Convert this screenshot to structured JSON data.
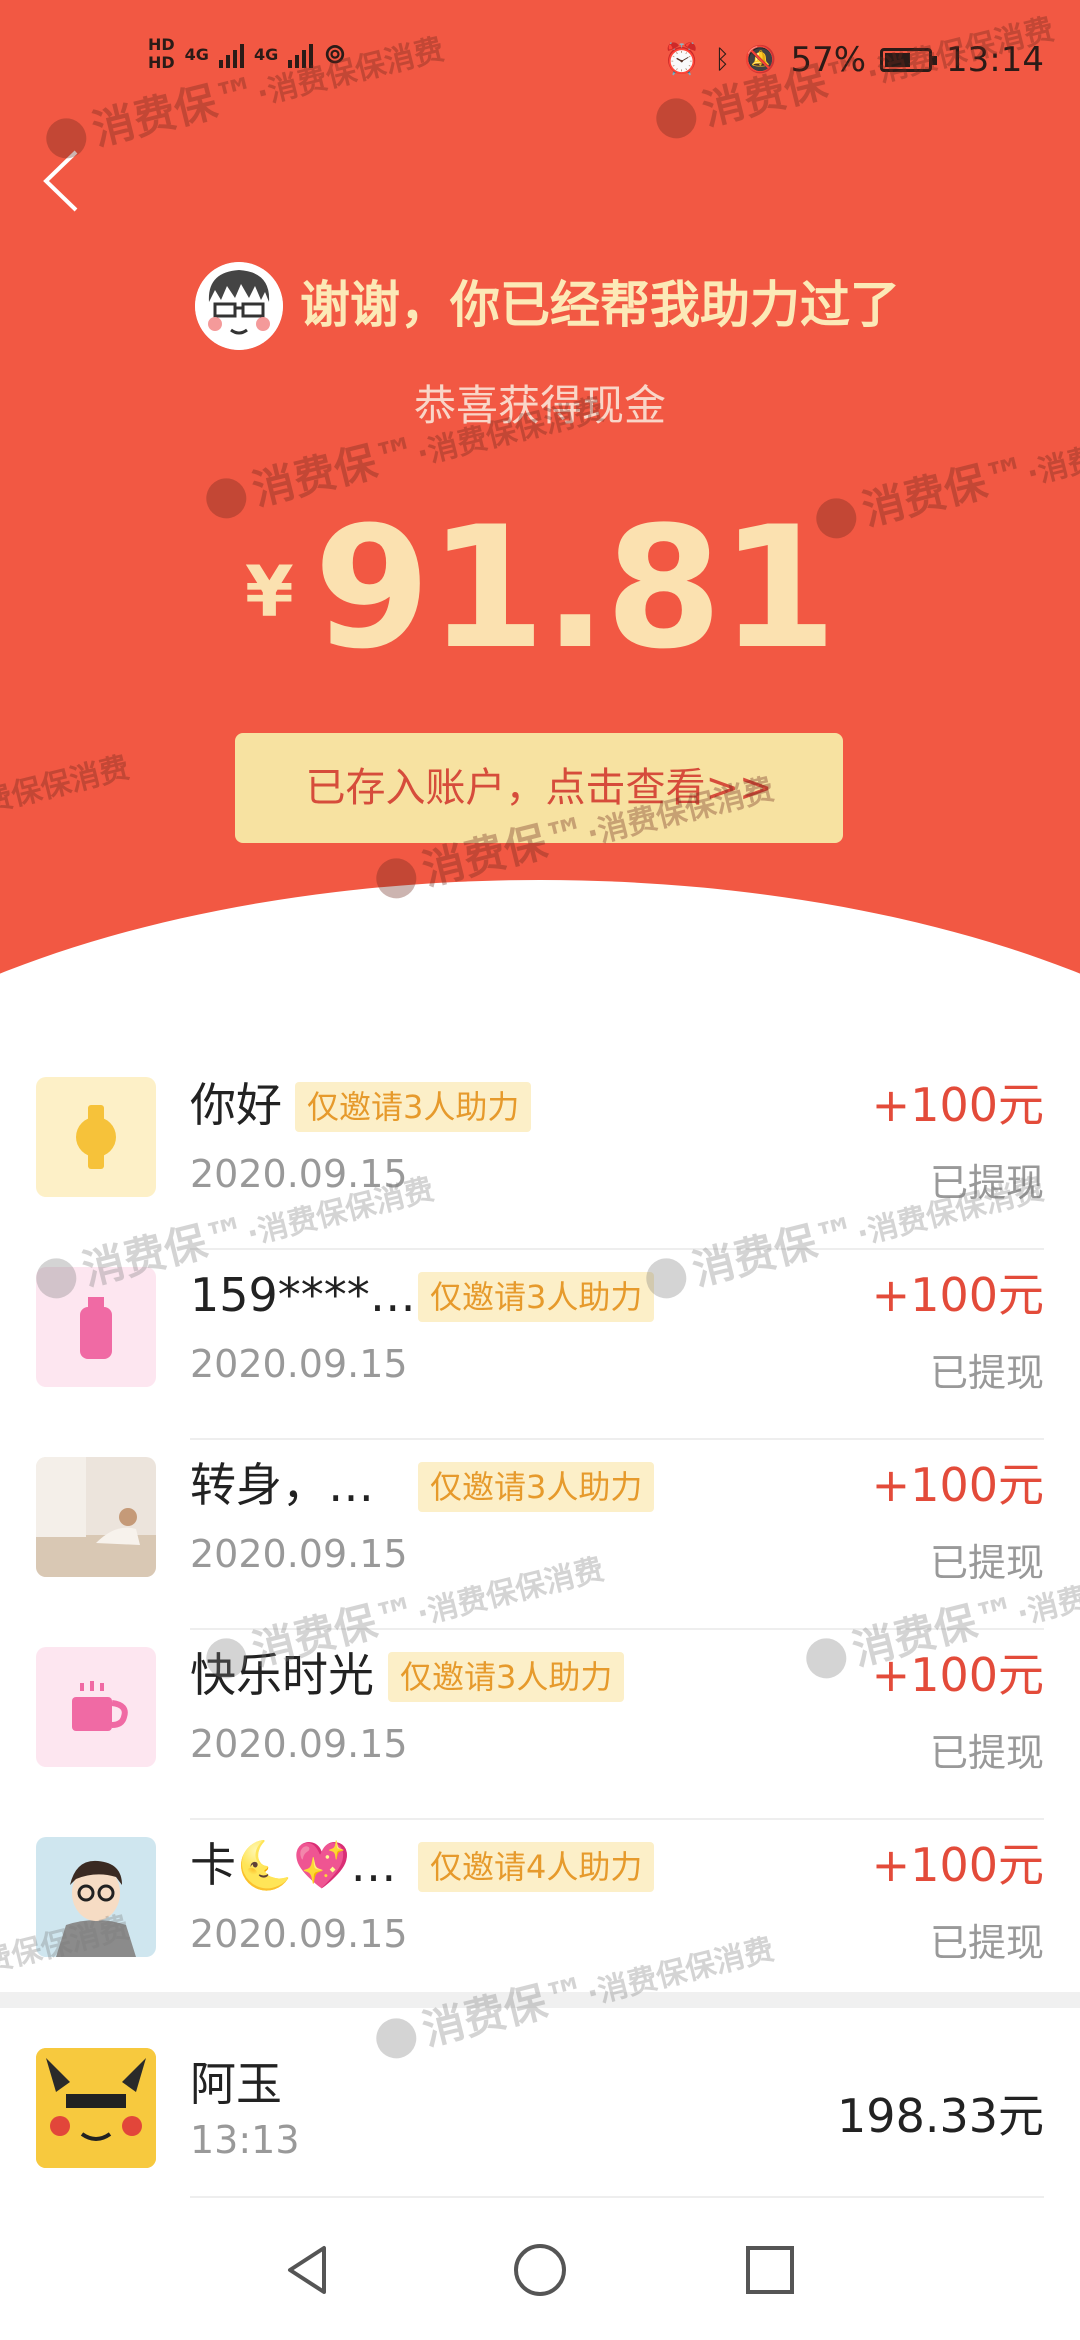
{
  "status_bar": {
    "hd_top": "HD",
    "hd_bottom": "HD",
    "net1": "4G",
    "net2": "4G",
    "battery_percent": "57%",
    "time": "13:14",
    "battery_level": 0.57
  },
  "header": {
    "thanks_text": "谢谢，你已经帮我助力过了",
    "congrats_text": "恭喜获得现金",
    "currency_symbol": "¥",
    "amount": "91.81",
    "deposit_button": "已存入账户，点击查看>>",
    "bg_color": "#f25843",
    "gold_color": "#fbe1b0"
  },
  "records": [
    {
      "name": "你好",
      "tag": "仅邀请3人助力",
      "date": "2020.09.15",
      "amount": "+100元",
      "status": "已提现",
      "thumb": "watch-icon"
    },
    {
      "name": "159****…",
      "tag": "仅邀请3人助力",
      "date": "2020.09.15",
      "amount": "+100元",
      "status": "已提现",
      "thumb": "bottle-icon"
    },
    {
      "name": "转身，…",
      "tag": "仅邀请3人助力",
      "date": "2020.09.15",
      "amount": "+100元",
      "status": "已提现",
      "thumb": "photo-avatar"
    },
    {
      "name": "快乐时光",
      "tag": "仅邀请3人助力",
      "date": "2020.09.15",
      "amount": "+100元",
      "status": "已提现",
      "thumb": "cup-icon"
    },
    {
      "name": "卡🌜💖…",
      "tag": "仅邀请4人助力",
      "date": "2020.09.15",
      "amount": "+100元",
      "status": "已提现",
      "thumb": "cartoon-avatar"
    }
  ],
  "bottom_record": {
    "name": "阿玉",
    "time": "13:13",
    "amount": "198.33元"
  },
  "watermark": {
    "brand": "消费保™",
    "slogan": "·消费保保消费",
    "fragment": "费保保消费"
  },
  "colors": {
    "accent_red": "#e34b3a",
    "tag_bg": "#fcefc8",
    "tag_text": "#e69a2c"
  }
}
